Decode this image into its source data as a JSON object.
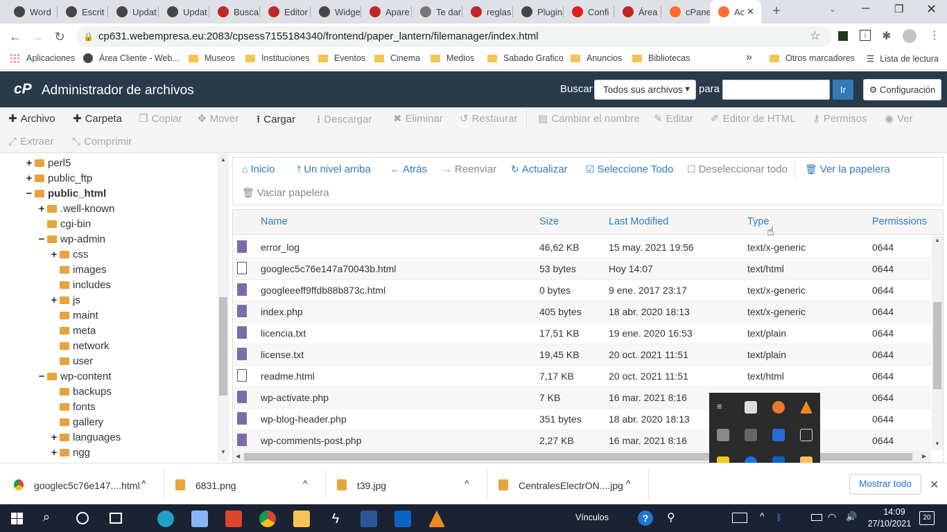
{
  "browser": {
    "tabs": [
      {
        "label": "Word",
        "icon": "wordpress-icon"
      },
      {
        "label": "Escrit",
        "icon": "wordpress-icon"
      },
      {
        "label": "Updat",
        "icon": "wordpress-icon"
      },
      {
        "label": "Updat",
        "icon": "wordpress-icon"
      },
      {
        "label": "Busca",
        "icon": "webempresa-icon"
      },
      {
        "label": "Editor",
        "icon": "webempresa-icon"
      },
      {
        "label": "Widge",
        "icon": "wordpress-icon"
      },
      {
        "label": "Apare",
        "icon": "webempresa-icon"
      },
      {
        "label": "Te dar",
        "icon": "usb-icon"
      },
      {
        "label": "reglas",
        "icon": "webempresa-icon"
      },
      {
        "label": "Plugin",
        "icon": "wordpress-icon"
      },
      {
        "label": "Confi",
        "icon": "youtube-icon"
      },
      {
        "label": "Área C",
        "icon": "webempresa-w-icon"
      },
      {
        "label": "cPane",
        "icon": "cpanel-icon"
      },
      {
        "label": "Ac",
        "icon": "cpanel-icon"
      }
    ],
    "url": "cp631.webempresa.eu:2083/cpsess7155184340/frontend/paper_lantern/filemanager/index.html",
    "bookmarks": [
      "Aplicaciones",
      "Área Cliente - Web...",
      "Museos",
      "Instituciones",
      "Eventos",
      "Cinema",
      "Medios",
      "Sabado Grafico",
      "Anuncios",
      "Bibliotecas",
      "»",
      "Otros marcadores",
      "Lista de lectura"
    ]
  },
  "header": {
    "title": "Administrador de archivos",
    "search_label": "Buscar",
    "search_scope": "Todos sus archivos",
    "for_label": "para",
    "go_label": "Ir",
    "settings_label": "Configuración"
  },
  "toolbar": {
    "items": [
      {
        "label": "Archivo",
        "icon": "plus-icon",
        "enabled": true
      },
      {
        "label": "Carpeta",
        "icon": "plus-icon",
        "enabled": true
      },
      {
        "label": "Copiar",
        "icon": "copy-icon",
        "enabled": false
      },
      {
        "label": "Mover",
        "icon": "move-icon",
        "enabled": false
      },
      {
        "label": "Cargar",
        "icon": "upload-icon",
        "enabled": true
      },
      {
        "label": "Descargar",
        "icon": "download-icon",
        "enabled": false
      },
      {
        "label": "Eliminar",
        "icon": "x-icon",
        "enabled": false
      },
      {
        "label": "Restaurar",
        "icon": "undo-icon",
        "enabled": false
      },
      {
        "label": "Cambiar el nombre",
        "icon": "file-icon",
        "enabled": false
      },
      {
        "label": "Editar",
        "icon": "pencil-icon",
        "enabled": false
      },
      {
        "label": "Editor de HTML",
        "icon": "edit-icon",
        "enabled": false
      },
      {
        "label": "Permisos",
        "icon": "key-icon",
        "enabled": false
      },
      {
        "label": "Ver",
        "icon": "eye-icon",
        "enabled": false
      },
      {
        "label": "Extraer",
        "icon": "expand-icon",
        "enabled": false
      },
      {
        "label": "Comprimir",
        "icon": "compress-icon",
        "enabled": false
      }
    ]
  },
  "tree": [
    {
      "label": "perl5",
      "toggle": "+",
      "bold": false
    },
    {
      "label": "public_ftp",
      "toggle": "+",
      "bold": false
    },
    {
      "label": "public_html",
      "toggle": "−",
      "bold": true
    },
    {
      "label": ".well-known",
      "toggle": "+",
      "bold": false
    },
    {
      "label": "cgi-bin",
      "toggle": "",
      "bold": false
    },
    {
      "label": "wp-admin",
      "toggle": "−",
      "bold": false
    },
    {
      "label": "css",
      "toggle": "+",
      "bold": false
    },
    {
      "label": "images",
      "toggle": "",
      "bold": false
    },
    {
      "label": "includes",
      "toggle": "",
      "bold": false
    },
    {
      "label": "js",
      "toggle": "+",
      "bold": false
    },
    {
      "label": "maint",
      "toggle": "",
      "bold": false
    },
    {
      "label": "meta",
      "toggle": "",
      "bold": false
    },
    {
      "label": "network",
      "toggle": "",
      "bold": false
    },
    {
      "label": "user",
      "toggle": "",
      "bold": false
    },
    {
      "label": "wp-content",
      "toggle": "−",
      "bold": false
    },
    {
      "label": "backups",
      "toggle": "",
      "bold": false
    },
    {
      "label": "fonts",
      "toggle": "",
      "bold": false
    },
    {
      "label": "gallery",
      "toggle": "",
      "bold": false
    },
    {
      "label": "languages",
      "toggle": "+",
      "bold": false
    },
    {
      "label": "ngg",
      "toggle": "+",
      "bold": false
    }
  ],
  "actions": [
    {
      "label": "Inicio",
      "icon": "home-icon",
      "enabled": true
    },
    {
      "label": "Un nivel arriba",
      "icon": "level-up-icon",
      "enabled": true
    },
    {
      "label": "Atrás",
      "icon": "arrow-left-icon",
      "enabled": true
    },
    {
      "label": "Reenviar",
      "icon": "arrow-right-icon",
      "enabled": false
    },
    {
      "label": "Actualizar",
      "icon": "refresh-icon",
      "enabled": true
    },
    {
      "label": "Seleccione Todo",
      "icon": "checkbox-checked-icon",
      "enabled": true
    },
    {
      "label": "Deseleccionar todo",
      "icon": "checkbox-empty-icon",
      "enabled": false
    },
    {
      "label": "Ver la papelera",
      "icon": "trash-icon",
      "enabled": true
    },
    {
      "label": "Vaciar papelera",
      "icon": "trash-icon",
      "enabled": false
    }
  ],
  "table": {
    "columns": [
      "Name",
      "Size",
      "Last Modified",
      "Type",
      "Permissions"
    ],
    "rows": [
      {
        "name": "error_log",
        "size": "46,62 KB",
        "modified": "15 may. 2021 19:56",
        "type": "text/x-generic",
        "perms": "0644",
        "icon": "text"
      },
      {
        "name": "googlec5c76e147a70043b.html",
        "size": "53 bytes",
        "modified": "Hoy 14:07",
        "type": "text/html",
        "perms": "0644",
        "icon": "html"
      },
      {
        "name": "googleeeff9ffdb88b873c.html",
        "size": "0 bytes",
        "modified": "9 ene. 2017 23:17",
        "type": "text/x-generic",
        "perms": "0644",
        "icon": "text"
      },
      {
        "name": "index.php",
        "size": "405 bytes",
        "modified": "18 abr. 2020 18:13",
        "type": "text/x-generic",
        "perms": "0644",
        "icon": "text"
      },
      {
        "name": "licencia.txt",
        "size": "17,51 KB",
        "modified": "19 ene. 2020 16:53",
        "type": "text/plain",
        "perms": "0644",
        "icon": "text"
      },
      {
        "name": "license.txt",
        "size": "19,45 KB",
        "modified": "20 oct. 2021 11:51",
        "type": "text/plain",
        "perms": "0644",
        "icon": "text"
      },
      {
        "name": "readme.html",
        "size": "7,17 KB",
        "modified": "20 oct. 2021 11:51",
        "type": "text/html",
        "perms": "0644",
        "icon": "html"
      },
      {
        "name": "wp-activate.php",
        "size": "7 KB",
        "modified": "16 mar. 2021 8:16",
        "type": "",
        "perms": "0644",
        "icon": "text"
      },
      {
        "name": "wp-blog-header.php",
        "size": "351 bytes",
        "modified": "18 abr. 2020 18:13",
        "type": "",
        "perms": "0644",
        "icon": "text"
      },
      {
        "name": "wp-comments-post.php",
        "size": "2,27 KB",
        "modified": "16 mar. 2021 8:16",
        "type": "",
        "perms": "0644",
        "icon": "text"
      }
    ]
  },
  "downloads": [
    {
      "label": "googlec5c76e147....html",
      "icon": "chrome-icon"
    },
    {
      "label": "6831.png",
      "icon": "image-file-icon"
    },
    {
      "label": "t39.jpg",
      "icon": "image-file-icon"
    },
    {
      "label": "CentralesElectrON....jpg",
      "icon": "image-file-icon"
    }
  ],
  "show_all_label": "Mostrar todo",
  "taskbar": {
    "links_label": "Vínculos",
    "time": "14:09",
    "date": "27/10/2021",
    "notifications": "20"
  },
  "colors": {
    "cpanel_header": "#293a4a",
    "link_blue": "#337ab7",
    "folder": "#e8a33d",
    "file_icon": "#7b6ca8"
  }
}
